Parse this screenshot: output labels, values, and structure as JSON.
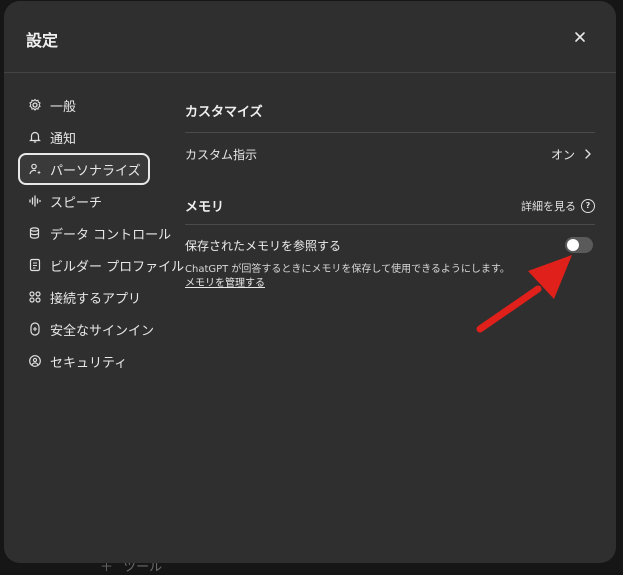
{
  "modal": {
    "title": "設定"
  },
  "sidebar": {
    "items": [
      {
        "label": "一般",
        "icon": "gear-icon"
      },
      {
        "label": "通知",
        "icon": "bell-icon"
      },
      {
        "label": "パーソナライズ",
        "icon": "person-sparkle-icon",
        "active": true
      },
      {
        "label": "スピーチ",
        "icon": "waveform-icon"
      },
      {
        "label": "データ コントロール",
        "icon": "database-icon"
      },
      {
        "label": "ビルダー プロファイル",
        "icon": "id-card-icon"
      },
      {
        "label": "接続するアプリ",
        "icon": "apps-grid-icon"
      },
      {
        "label": "安全なサインイン",
        "icon": "key-icon"
      },
      {
        "label": "セキュリティ",
        "icon": "shield-icon"
      }
    ]
  },
  "content": {
    "customize_title": "カスタマイズ",
    "custom_instructions_label": "カスタム指示",
    "custom_instructions_value": "オン",
    "memory_title": "メモリ",
    "details_label": "詳細を見る",
    "reference_memory_label": "保存されたメモリを参照する",
    "reference_memory_enabled": false,
    "description": "ChatGPT が回答するときにメモリを保存して使用できるようにします。",
    "manage_memory_label": "メモリを管理する"
  },
  "background": {
    "hint_text": "ツール"
  },
  "colors": {
    "modal_bg": "#2f2f2f",
    "backdrop": "#161616",
    "arrow": "#e0201a",
    "toggle_off": "#5a5a5a"
  }
}
